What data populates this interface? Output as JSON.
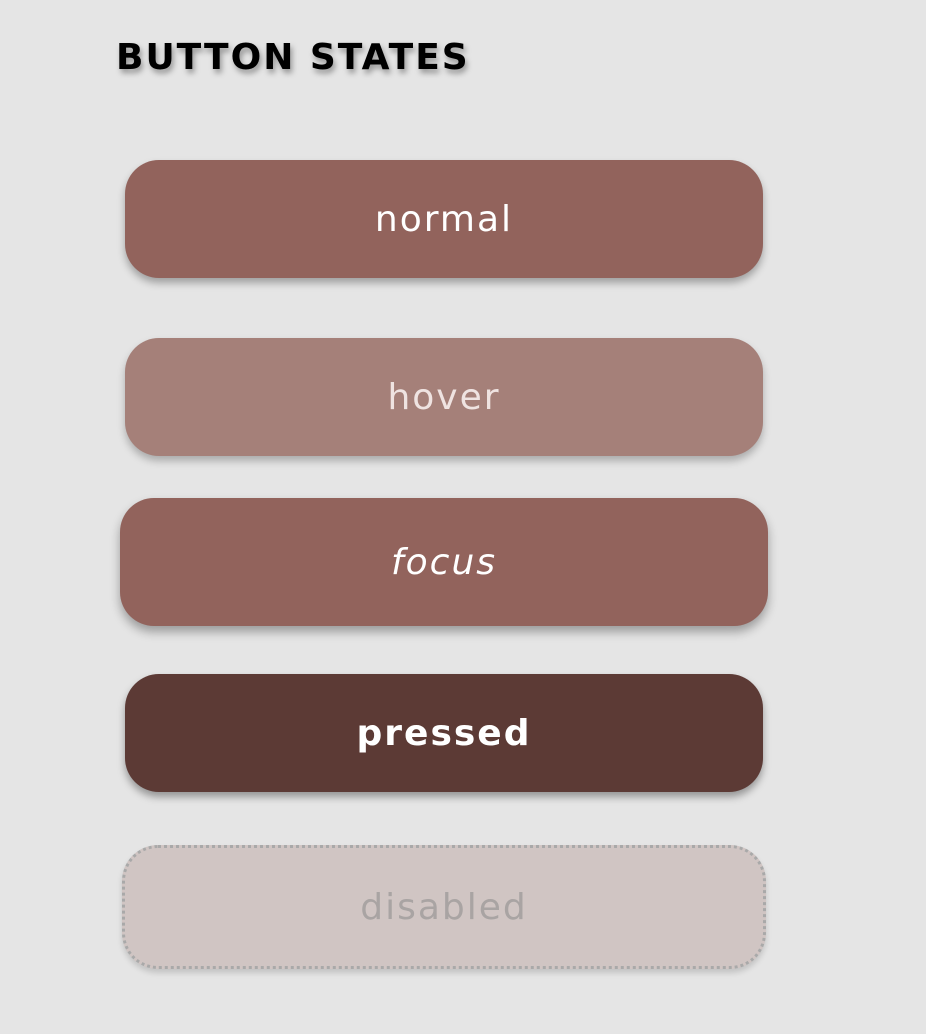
{
  "page": {
    "title": "BUTTON STATES"
  },
  "buttons": {
    "normal": "normal",
    "hover": "hover",
    "focus": "focus",
    "pressed": "pressed",
    "disabled": "disabled"
  },
  "colors": {
    "background": "#e5e5e5",
    "normal": "#92635c",
    "hover": "#a58079",
    "focus": "#92635c",
    "pressed": "#5c3a35",
    "disabled": "#d0c5c3"
  }
}
